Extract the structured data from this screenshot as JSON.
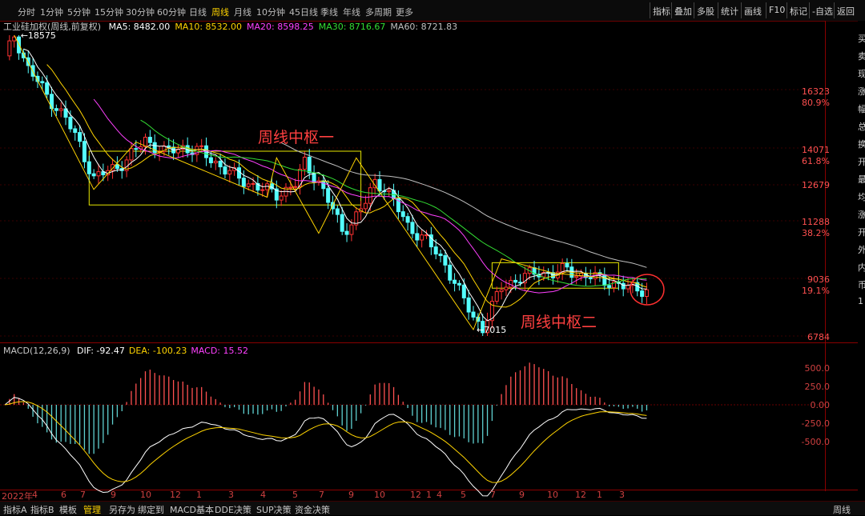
{
  "period_tabs": [
    "分时",
    "1分钟",
    "5分钟",
    "15分钟",
    "30分钟",
    "60分钟",
    "日线",
    "周线",
    "月线",
    "10分钟",
    "45日线",
    "季线",
    "年线",
    "多周期",
    "更多"
  ],
  "active_period": "周线",
  "right_tools": [
    "指标",
    "叠加",
    "多股",
    "统计",
    "画线",
    "F10",
    "标记",
    "-自选",
    "返回"
  ],
  "ma_legend": {
    "title": "工业硅加权(周线,前复权)",
    "items": [
      {
        "text": "MA5: 8482.00",
        "color": "#ffffff"
      },
      {
        "text": "MA10: 8532.00",
        "color": "#ffd400"
      },
      {
        "text": "MA20: 8598.25",
        "color": "#ff40ff"
      },
      {
        "text": "MA30: 8716.67",
        "color": "#33dd33"
      },
      {
        "text": "MA60: 8721.83",
        "color": "#c0c0c0"
      }
    ]
  },
  "macd_legend": {
    "title": "MACD(12,26,9)",
    "items": [
      {
        "text": "DIF: -92.47",
        "color": "#ffffff"
      },
      {
        "text": "DEA: -100.23",
        "color": "#ffd400"
      },
      {
        "text": "MACD: 15.52",
        "color": "#ff40ff"
      }
    ]
  },
  "annotations": {
    "zone1": "周线中枢一",
    "zone2": "周线中枢二",
    "high_label": "18575",
    "low_label": "7015"
  },
  "price_axis_labels": [
    {
      "text": "16323",
      "color": "#ff5050"
    },
    {
      "text": "80.9%",
      "color": "#ff5050"
    },
    {
      "text": "14071",
      "color": "#ff5050"
    },
    {
      "text": "61.8%",
      "color": "#ff5050"
    },
    {
      "text": "12679",
      "color": "#ff5050"
    },
    {
      "text": "11288",
      "color": "#ff5050"
    },
    {
      "text": "38.2%",
      "color": "#ff5050"
    },
    {
      "text": "9036",
      "color": "#ff5050"
    },
    {
      "text": "19.1%",
      "color": "#ff5050"
    },
    {
      "text": "6784",
      "color": "#ff5050"
    }
  ],
  "macd_axis_labels": [
    "500.0",
    "250.0",
    "0.00",
    "-250.0",
    "-500.0"
  ],
  "x_axis_labels": [
    "2022年",
    "4",
    "6",
    "7",
    "9",
    "10",
    "12",
    "1",
    "3",
    "4",
    "5",
    "7",
    "9",
    "10",
    "12",
    "1",
    "4",
    "5",
    "7",
    "9",
    "10",
    "12",
    "1",
    "3"
  ],
  "bottom_tabs": [
    "指标A",
    "指标B",
    "模板",
    "管理",
    "另存为",
    "绑定到",
    "MACD基本",
    "DDE决策",
    "SUP决策",
    "资金决策"
  ],
  "active_bottom_tab": "管理",
  "bottom_right_tab": "周线",
  "sidebar_glyphs": [
    "买",
    "卖",
    "现",
    "涨",
    "幅",
    "总",
    "换",
    "开",
    "最",
    "均",
    "涨",
    "开",
    "外",
    "内",
    "币",
    "1"
  ],
  "chart_data": {
    "type": "candlestick",
    "symbol": "工业硅加权",
    "period": "周线",
    "price_range": [
      6784,
      18575
    ],
    "marked_levels": [
      16323,
      14071,
      12679,
      11288,
      9036,
      6784
    ],
    "fib_levels": [
      "80.9%",
      "61.8%",
      "38.2%",
      "19.1%"
    ],
    "close_path": [
      [
        0,
        17600
      ],
      [
        2,
        18575
      ],
      [
        5,
        17200
      ],
      [
        9,
        16100
      ],
      [
        13,
        15200
      ],
      [
        16,
        14200
      ],
      [
        19,
        12900
      ],
      [
        22,
        13200
      ],
      [
        26,
        13600
      ],
      [
        30,
        14400
      ],
      [
        34,
        13900
      ],
      [
        38,
        14100
      ],
      [
        42,
        13900
      ],
      [
        46,
        13400
      ],
      [
        50,
        12900
      ],
      [
        54,
        12600
      ],
      [
        58,
        12300
      ],
      [
        62,
        12700
      ],
      [
        64,
        13500
      ],
      [
        67,
        12800
      ],
      [
        70,
        11700
      ],
      [
        72,
        10900
      ],
      [
        74,
        11200
      ],
      [
        77,
        12000
      ],
      [
        79,
        12800
      ],
      [
        81,
        12600
      ],
      [
        83,
        12000
      ],
      [
        86,
        11100
      ],
      [
        90,
        10500
      ],
      [
        94,
        9600
      ],
      [
        97,
        8500
      ],
      [
        100,
        7500
      ],
      [
        102,
        7100
      ],
      [
        104,
        7900
      ],
      [
        106,
        8700
      ],
      [
        108,
        8900
      ],
      [
        111,
        9100
      ],
      [
        114,
        9300
      ],
      [
        117,
        9200
      ],
      [
        120,
        9400
      ],
      [
        123,
        9150
      ],
      [
        126,
        9050
      ],
      [
        129,
        8900
      ],
      [
        132,
        8700
      ],
      [
        134,
        8650
      ],
      [
        137,
        8600
      ]
    ],
    "ma": {
      "MA5": 8482.0,
      "MA10": 8532.0,
      "MA20": 8598.25,
      "MA30": 8716.67,
      "MA60": 8721.83
    },
    "macd_range": [
      -700,
      650
    ],
    "macd_params": "12,26,9",
    "macd": {
      "DIF": -92.47,
      "DEA": -100.23,
      "MACD": 15.52
    },
    "consolidation_zones": [
      {
        "name": "周线中枢一",
        "price_range": [
          11900,
          13950
        ]
      },
      {
        "name": "周线中枢二",
        "price_range": [
          8650,
          9650
        ]
      }
    ]
  }
}
